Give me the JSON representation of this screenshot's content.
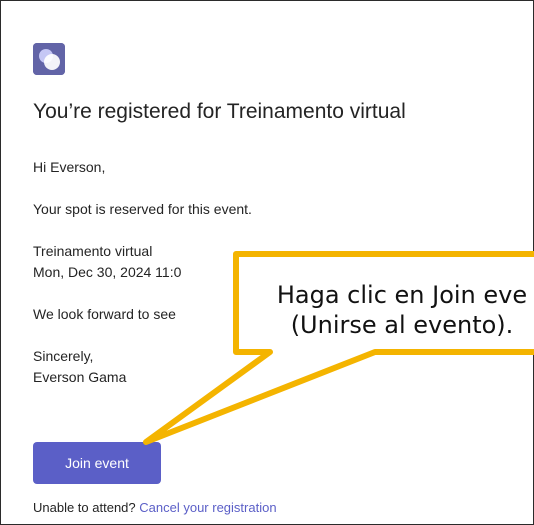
{
  "email": {
    "title": "You’re registered for Treinamento virtual",
    "greeting": "Hi Everson,",
    "spot_text": "Your spot is reserved for this event.",
    "event_name": "Treinamento virtual",
    "event_datetime": "Mon, Dec 30, 2024 11:0",
    "look_forward": "We look forward to see",
    "closing": "Sincerely,",
    "sender": "Everson Gama",
    "join_button_label": "Join event",
    "unable_text": "Unable to attend?",
    "cancel_link_label": "Cancel your registration"
  },
  "callout": {
    "line1": "Haga clic en Join eve",
    "line2": "(Unirse al evento)."
  },
  "colors": {
    "accent": "#5b5fc7",
    "callout_border": "#f4b400",
    "callout_fill": "#ffffff"
  },
  "icons": {
    "app": "teams-events-icon"
  }
}
